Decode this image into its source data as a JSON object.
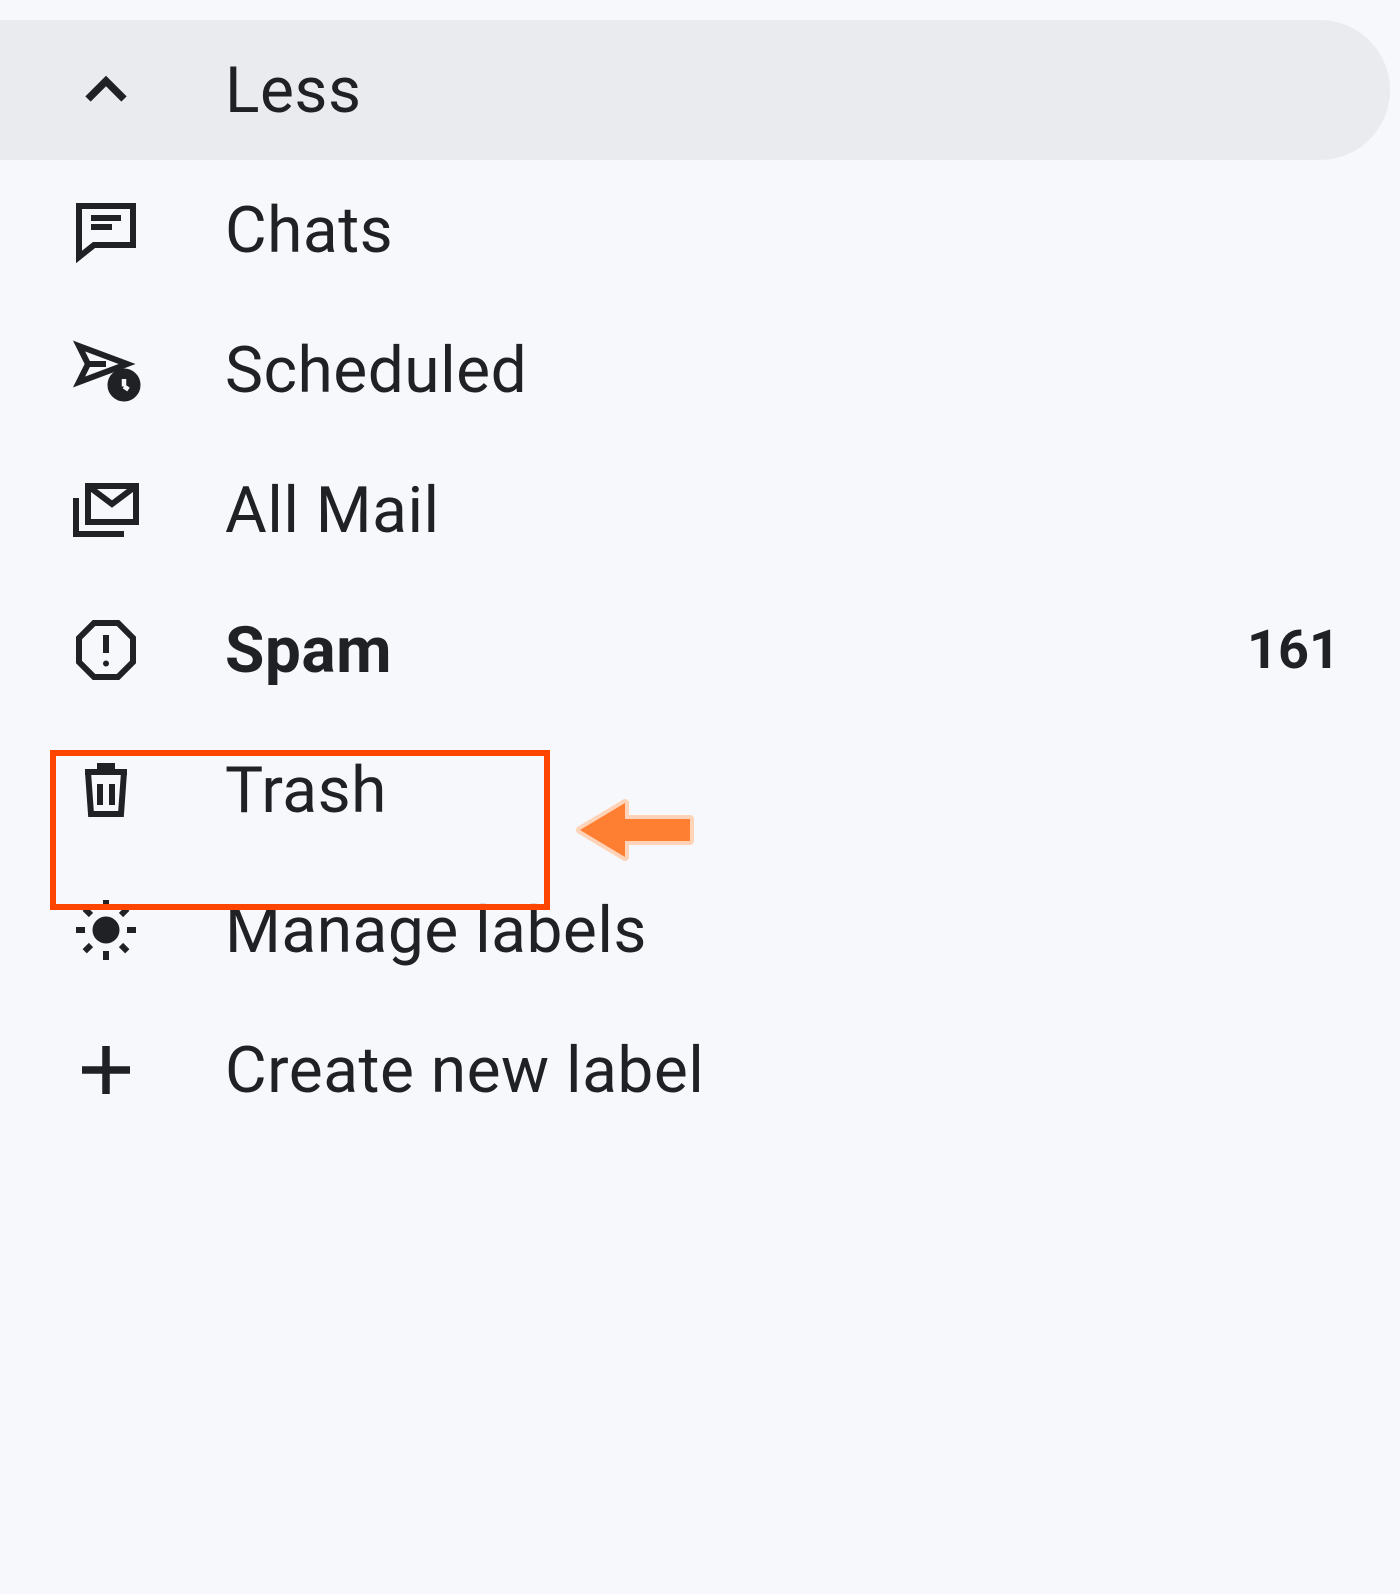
{
  "sidebar": {
    "less": {
      "label": "Less"
    },
    "items": [
      {
        "icon": "chats-icon",
        "label": "Chats",
        "bold": false,
        "count": null
      },
      {
        "icon": "scheduled-icon",
        "label": "Scheduled",
        "bold": false,
        "count": null
      },
      {
        "icon": "all-mail-icon",
        "label": "All Mail",
        "bold": false,
        "count": null
      },
      {
        "icon": "spam-icon",
        "label": "Spam",
        "bold": true,
        "count": "161"
      },
      {
        "icon": "trash-icon",
        "label": "Trash",
        "bold": false,
        "count": null
      },
      {
        "icon": "gear-icon",
        "label": "Manage labels",
        "bold": false,
        "count": null
      },
      {
        "icon": "plus-icon",
        "label": "Create new label",
        "bold": false,
        "count": null
      }
    ]
  },
  "annotation": {
    "highlighted": "Trash"
  }
}
